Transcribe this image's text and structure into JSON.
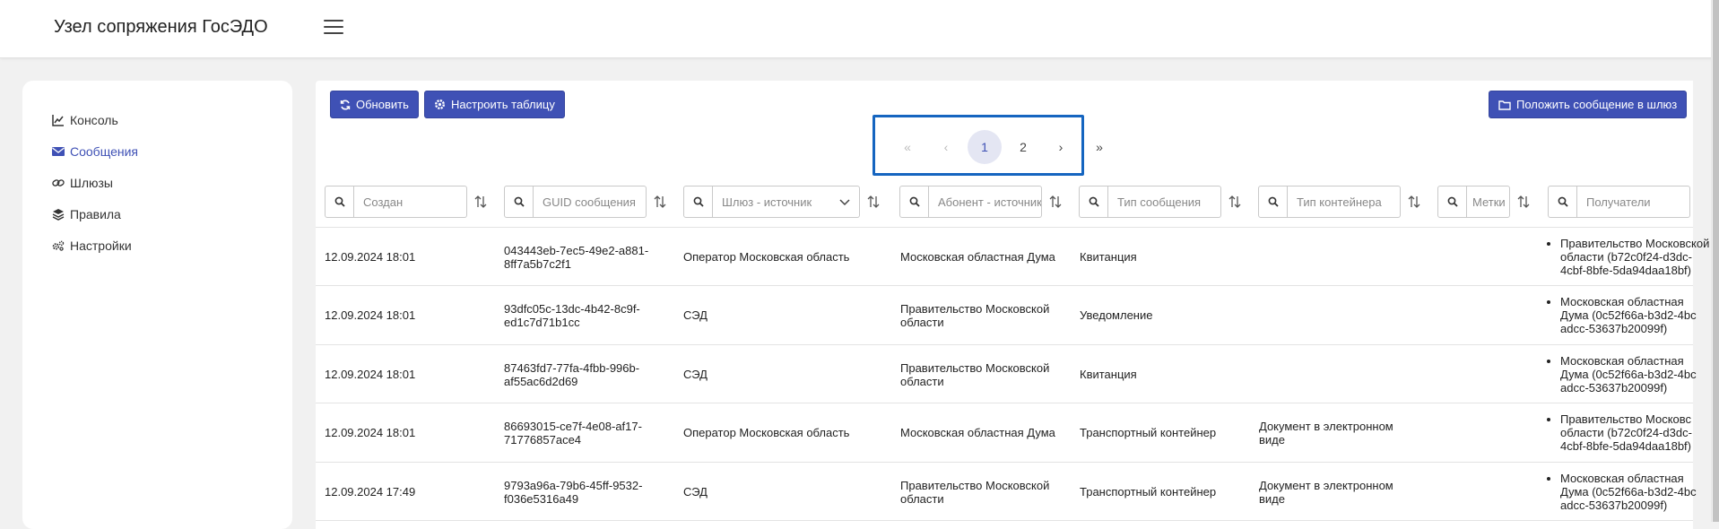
{
  "header": {
    "title": "Узел сопряжения ГосЭДО"
  },
  "sidebar": {
    "items": [
      {
        "label": "Консоль",
        "icon": "chart-line-icon"
      },
      {
        "label": "Сообщения",
        "icon": "envelope-icon"
      },
      {
        "label": "Шлюзы",
        "icon": "link-icon"
      },
      {
        "label": "Правила",
        "icon": "layers-icon"
      },
      {
        "label": "Настройки",
        "icon": "cogs-icon"
      }
    ],
    "active_index": 1
  },
  "toolbar": {
    "refresh_label": "Обновить",
    "configure_label": "Настроить таблицу",
    "put_message_label": "Положить сообщение в шлюз"
  },
  "pagination": {
    "first": "«",
    "prev": "‹",
    "pages": [
      "1",
      "2"
    ],
    "current": "1",
    "next": "›",
    "last": "»"
  },
  "filters": {
    "created": "Создан",
    "guid": "GUID сообщения",
    "gateway_source": "Шлюз - источник",
    "subscriber_source": "Абонент - источник",
    "message_type": "Тип сообщения",
    "container_type": "Тип контейнера",
    "tags": "Метки",
    "recipients": "Получатели"
  },
  "rows": [
    {
      "created": "12.09.2024 18:01",
      "guid_1": "043443eb-7ec5-49e2-a881-",
      "guid_2": "8ff7a5b7c2f1",
      "gateway": "Оператор Московская область",
      "subscriber_1": "Московская областная Дума",
      "subscriber_2": "",
      "type": "Квитанция",
      "container_1": "",
      "container_2": "",
      "recipient_1": "Правительство Московской",
      "recipient_2": "области (b72c0f24-d3dc-",
      "recipient_3": "4cbf-8bfe-5da94daa18bf)"
    },
    {
      "created": "12.09.2024 18:01",
      "guid_1": "93dfc05c-13dc-4b42-8c9f-",
      "guid_2": "ed1c7d71b1cc",
      "gateway": "СЭД",
      "subscriber_1": "Правительство Московской",
      "subscriber_2": "области",
      "type": "Уведомление",
      "container_1": "",
      "container_2": "",
      "recipient_1": "Московская областная",
      "recipient_2": "Дума (0c52f66a-b3d2-4bc",
      "recipient_3": "adcc-53637b20099f)"
    },
    {
      "created": "12.09.2024 18:01",
      "guid_1": "87463fd7-77fa-4fbb-996b-",
      "guid_2": "af55ac6d2d69",
      "gateway": "СЭД",
      "subscriber_1": "Правительство Московской",
      "subscriber_2": "области",
      "type": "Квитанция",
      "container_1": "",
      "container_2": "",
      "recipient_1": "Московская областная",
      "recipient_2": "Дума (0c52f66a-b3d2-4bc",
      "recipient_3": "adcc-53637b20099f)"
    },
    {
      "created": "12.09.2024 18:01",
      "guid_1": "86693015-ce7f-4e08-af17-",
      "guid_2": "71776857ace4",
      "gateway": "Оператор Московская область",
      "subscriber_1": "Московская областная Дума",
      "subscriber_2": "",
      "type": "Транспортный контейнер",
      "container_1": "Документ в электронном",
      "container_2": "виде",
      "recipient_1": "Правительство Московс",
      "recipient_2": "области (b72c0f24-d3dc-",
      "recipient_3": "4cbf-8bfe-5da94daa18bf)"
    },
    {
      "created": "12.09.2024 17:49",
      "guid_1": "9793a96a-79b6-45ff-9532-",
      "guid_2": "f036e5316a49",
      "gateway": "СЭД",
      "subscriber_1": "Правительство Московской",
      "subscriber_2": "области",
      "type": "Транспортный контейнер",
      "container_1": "Документ в электронном",
      "container_2": "виде",
      "recipient_1": "Московская областная",
      "recipient_2": "Дума (0c52f66a-b3d2-4bc",
      "recipient_3": "adcc-53637b20099f)"
    }
  ],
  "colors": {
    "accent": "#3f51b5",
    "pager_outline": "#1565c0",
    "background": "#f1f1f1"
  }
}
